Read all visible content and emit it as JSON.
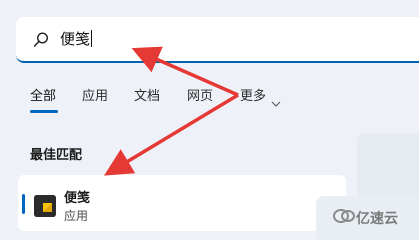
{
  "search": {
    "query": "便笺",
    "icon": "search-icon"
  },
  "tabs": [
    {
      "label": "全部",
      "active": true
    },
    {
      "label": "应用",
      "active": false
    },
    {
      "label": "文档",
      "active": false
    },
    {
      "label": "网页",
      "active": false
    },
    {
      "label": "更多",
      "active": false,
      "icon": "chevron-down-icon"
    }
  ],
  "best_match": {
    "title": "最佳匹配",
    "result": {
      "name": "便笺",
      "type": "应用",
      "icon": "sticky-notes-icon"
    }
  },
  "watermark": {
    "text": "亿速云",
    "icon": "yisu-cloud-logo"
  },
  "colors": {
    "accent": "#0067c0",
    "arrow": "#e53935",
    "background": "#eef2f8"
  }
}
